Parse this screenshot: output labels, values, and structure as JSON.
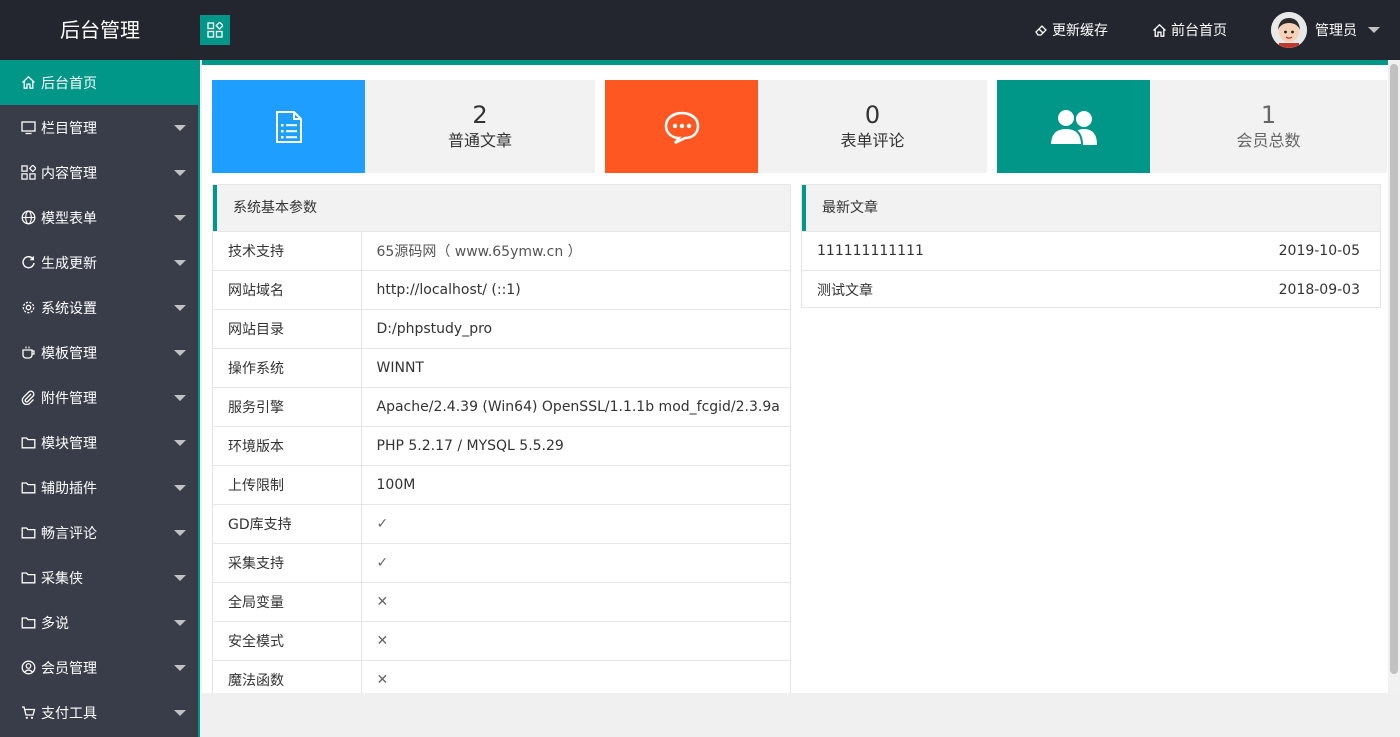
{
  "header": {
    "brand": "后台管理",
    "clear_cache": "更新缓存",
    "front_home": "前台首页",
    "user": "管理员"
  },
  "sidebar": {
    "items": [
      {
        "label": "后台首页",
        "icon": "home-icon"
      },
      {
        "label": "栏目管理",
        "icon": "monitor-icon"
      },
      {
        "label": "内容管理",
        "icon": "apps-icon"
      },
      {
        "label": "模型表单",
        "icon": "globe-icon"
      },
      {
        "label": "生成更新",
        "icon": "refresh-icon"
      },
      {
        "label": "系统设置",
        "icon": "gear-icon"
      },
      {
        "label": "模板管理",
        "icon": "cup-icon"
      },
      {
        "label": "附件管理",
        "icon": "paperclip-icon"
      },
      {
        "label": "模块管理",
        "icon": "folder-icon"
      },
      {
        "label": "辅助插件",
        "icon": "folder-icon"
      },
      {
        "label": "畅言评论",
        "icon": "folder-icon"
      },
      {
        "label": "采集侠",
        "icon": "folder-icon"
      },
      {
        "label": "多说",
        "icon": "folder-icon"
      },
      {
        "label": "会员管理",
        "icon": "user-circle-icon"
      },
      {
        "label": "支付工具",
        "icon": "cart-icon"
      }
    ]
  },
  "stats": [
    {
      "value": "2",
      "label": "普通文章",
      "color": "#1e9fff",
      "icon": "document-icon"
    },
    {
      "value": "0",
      "label": "表单评论",
      "color": "#ff5722",
      "icon": "chat-icon"
    },
    {
      "value": "1",
      "label": "会员总数",
      "color": "#009688",
      "icon": "users-icon"
    }
  ],
  "sys_panel": {
    "title": "系统基本参数",
    "rows": [
      {
        "key": "技术支持",
        "value": "65源码网（ www.65ymw.cn ）"
      },
      {
        "key": "网站域名",
        "value": "http://localhost/ (::1)"
      },
      {
        "key": "网站目录",
        "value": "D:/phpstudy_pro"
      },
      {
        "key": "操作系统",
        "value": "WINNT"
      },
      {
        "key": "服务引擎",
        "value": "Apache/2.4.39 (Win64) OpenSSL/1.1.1b mod_fcgid/2.3.9a"
      },
      {
        "key": "环境版本",
        "value": "PHP 5.2.17 / MYSQL 5.5.29"
      },
      {
        "key": "上传限制",
        "value": "100M"
      },
      {
        "key": "GD库支持",
        "value": "✓"
      },
      {
        "key": "采集支持",
        "value": "✓"
      },
      {
        "key": "全局变量",
        "value": "✕"
      },
      {
        "key": "安全模式",
        "value": "✕"
      },
      {
        "key": "魔法函数",
        "value": "✕"
      }
    ]
  },
  "news_panel": {
    "title": "最新文章",
    "rows": [
      {
        "title": "111111111111",
        "date": "2019-10-05"
      },
      {
        "title": "测试文章",
        "date": "2018-09-03"
      }
    ]
  },
  "colors": {
    "accent": "#009688",
    "topbar": "#23262e",
    "sidebar": "#393d49"
  }
}
